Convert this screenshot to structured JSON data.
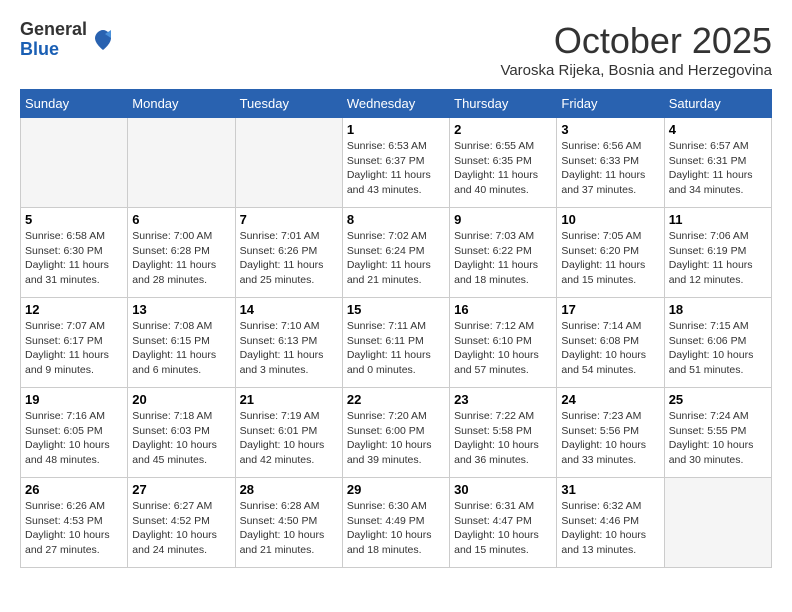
{
  "logo": {
    "general": "General",
    "blue": "Blue"
  },
  "title": "October 2025",
  "subtitle": "Varoska Rijeka, Bosnia and Herzegovina",
  "headers": [
    "Sunday",
    "Monday",
    "Tuesday",
    "Wednesday",
    "Thursday",
    "Friday",
    "Saturday"
  ],
  "weeks": [
    [
      {
        "day": "",
        "info": ""
      },
      {
        "day": "",
        "info": ""
      },
      {
        "day": "",
        "info": ""
      },
      {
        "day": "1",
        "info": "Sunrise: 6:53 AM\nSunset: 6:37 PM\nDaylight: 11 hours\nand 43 minutes."
      },
      {
        "day": "2",
        "info": "Sunrise: 6:55 AM\nSunset: 6:35 PM\nDaylight: 11 hours\nand 40 minutes."
      },
      {
        "day": "3",
        "info": "Sunrise: 6:56 AM\nSunset: 6:33 PM\nDaylight: 11 hours\nand 37 minutes."
      },
      {
        "day": "4",
        "info": "Sunrise: 6:57 AM\nSunset: 6:31 PM\nDaylight: 11 hours\nand 34 minutes."
      }
    ],
    [
      {
        "day": "5",
        "info": "Sunrise: 6:58 AM\nSunset: 6:30 PM\nDaylight: 11 hours\nand 31 minutes."
      },
      {
        "day": "6",
        "info": "Sunrise: 7:00 AM\nSunset: 6:28 PM\nDaylight: 11 hours\nand 28 minutes."
      },
      {
        "day": "7",
        "info": "Sunrise: 7:01 AM\nSunset: 6:26 PM\nDaylight: 11 hours\nand 25 minutes."
      },
      {
        "day": "8",
        "info": "Sunrise: 7:02 AM\nSunset: 6:24 PM\nDaylight: 11 hours\nand 21 minutes."
      },
      {
        "day": "9",
        "info": "Sunrise: 7:03 AM\nSunset: 6:22 PM\nDaylight: 11 hours\nand 18 minutes."
      },
      {
        "day": "10",
        "info": "Sunrise: 7:05 AM\nSunset: 6:20 PM\nDaylight: 11 hours\nand 15 minutes."
      },
      {
        "day": "11",
        "info": "Sunrise: 7:06 AM\nSunset: 6:19 PM\nDaylight: 11 hours\nand 12 minutes."
      }
    ],
    [
      {
        "day": "12",
        "info": "Sunrise: 7:07 AM\nSunset: 6:17 PM\nDaylight: 11 hours\nand 9 minutes."
      },
      {
        "day": "13",
        "info": "Sunrise: 7:08 AM\nSunset: 6:15 PM\nDaylight: 11 hours\nand 6 minutes."
      },
      {
        "day": "14",
        "info": "Sunrise: 7:10 AM\nSunset: 6:13 PM\nDaylight: 11 hours\nand 3 minutes."
      },
      {
        "day": "15",
        "info": "Sunrise: 7:11 AM\nSunset: 6:11 PM\nDaylight: 11 hours\nand 0 minutes."
      },
      {
        "day": "16",
        "info": "Sunrise: 7:12 AM\nSunset: 6:10 PM\nDaylight: 10 hours\nand 57 minutes."
      },
      {
        "day": "17",
        "info": "Sunrise: 7:14 AM\nSunset: 6:08 PM\nDaylight: 10 hours\nand 54 minutes."
      },
      {
        "day": "18",
        "info": "Sunrise: 7:15 AM\nSunset: 6:06 PM\nDaylight: 10 hours\nand 51 minutes."
      }
    ],
    [
      {
        "day": "19",
        "info": "Sunrise: 7:16 AM\nSunset: 6:05 PM\nDaylight: 10 hours\nand 48 minutes."
      },
      {
        "day": "20",
        "info": "Sunrise: 7:18 AM\nSunset: 6:03 PM\nDaylight: 10 hours\nand 45 minutes."
      },
      {
        "day": "21",
        "info": "Sunrise: 7:19 AM\nSunset: 6:01 PM\nDaylight: 10 hours\nand 42 minutes."
      },
      {
        "day": "22",
        "info": "Sunrise: 7:20 AM\nSunset: 6:00 PM\nDaylight: 10 hours\nand 39 minutes."
      },
      {
        "day": "23",
        "info": "Sunrise: 7:22 AM\nSunset: 5:58 PM\nDaylight: 10 hours\nand 36 minutes."
      },
      {
        "day": "24",
        "info": "Sunrise: 7:23 AM\nSunset: 5:56 PM\nDaylight: 10 hours\nand 33 minutes."
      },
      {
        "day": "25",
        "info": "Sunrise: 7:24 AM\nSunset: 5:55 PM\nDaylight: 10 hours\nand 30 minutes."
      }
    ],
    [
      {
        "day": "26",
        "info": "Sunrise: 6:26 AM\nSunset: 4:53 PM\nDaylight: 10 hours\nand 27 minutes."
      },
      {
        "day": "27",
        "info": "Sunrise: 6:27 AM\nSunset: 4:52 PM\nDaylight: 10 hours\nand 24 minutes."
      },
      {
        "day": "28",
        "info": "Sunrise: 6:28 AM\nSunset: 4:50 PM\nDaylight: 10 hours\nand 21 minutes."
      },
      {
        "day": "29",
        "info": "Sunrise: 6:30 AM\nSunset: 4:49 PM\nDaylight: 10 hours\nand 18 minutes."
      },
      {
        "day": "30",
        "info": "Sunrise: 6:31 AM\nSunset: 4:47 PM\nDaylight: 10 hours\nand 15 minutes."
      },
      {
        "day": "31",
        "info": "Sunrise: 6:32 AM\nSunset: 4:46 PM\nDaylight: 10 hours\nand 13 minutes."
      },
      {
        "day": "",
        "info": ""
      }
    ]
  ]
}
